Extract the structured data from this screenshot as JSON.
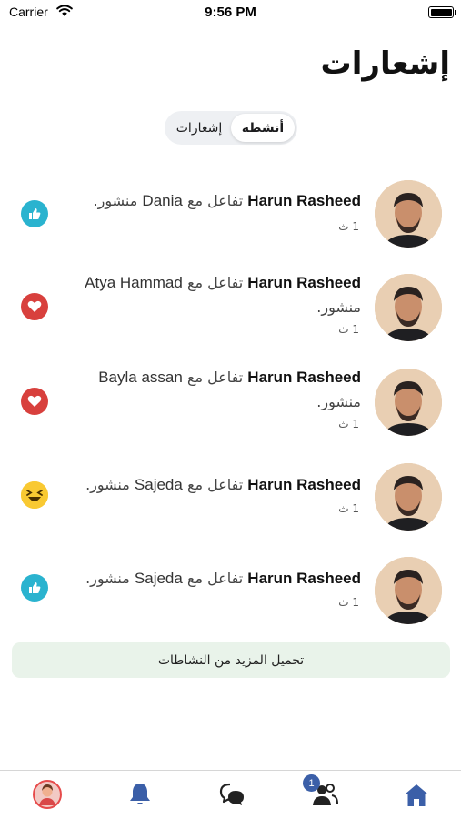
{
  "status_bar": {
    "carrier": "Carrier",
    "time": "9:56 PM"
  },
  "page": {
    "title": "إشعارات"
  },
  "tabs": {
    "activity": "أنشطة",
    "notifications": "إشعارات",
    "selected": "activity"
  },
  "notifications": [
    {
      "actor": "Harun Rasheed",
      "verb": "تفاعل مع",
      "target": "Dania",
      "object": "منشور.",
      "time": "1 ث",
      "reaction": "like"
    },
    {
      "actor": "Harun Rasheed",
      "verb": "تفاعل مع",
      "target": "Atya Hammad",
      "object": "منشور.",
      "time": "1 ث",
      "reaction": "love"
    },
    {
      "actor": "Harun Rasheed",
      "verb": "تفاعل مع",
      "target": "Bayla assan",
      "object": "منشور.",
      "time": "1 ث",
      "reaction": "love"
    },
    {
      "actor": "Harun Rasheed",
      "verb": "تفاعل مع",
      "target": "Sajeda",
      "object": "منشور.",
      "time": "1 ث",
      "reaction": "haha"
    },
    {
      "actor": "Harun Rasheed",
      "verb": "تفاعل مع",
      "target": "Sajeda",
      "object": "منشور.",
      "time": "1 ث",
      "reaction": "like"
    }
  ],
  "load_more": "تحميل المزيد من النشاطات",
  "tab_bar": {
    "items": [
      "profile-avatar",
      "bell-icon",
      "chat-bubble-icon",
      "friends-icon",
      "home-icon"
    ],
    "friends_badge": "1",
    "accent": "#3b5fa8"
  },
  "colors": {
    "like": "#2ab3cf",
    "love": "#d8403d",
    "haha": "#f9c932",
    "load_more_bg": "#e9f3ea"
  }
}
